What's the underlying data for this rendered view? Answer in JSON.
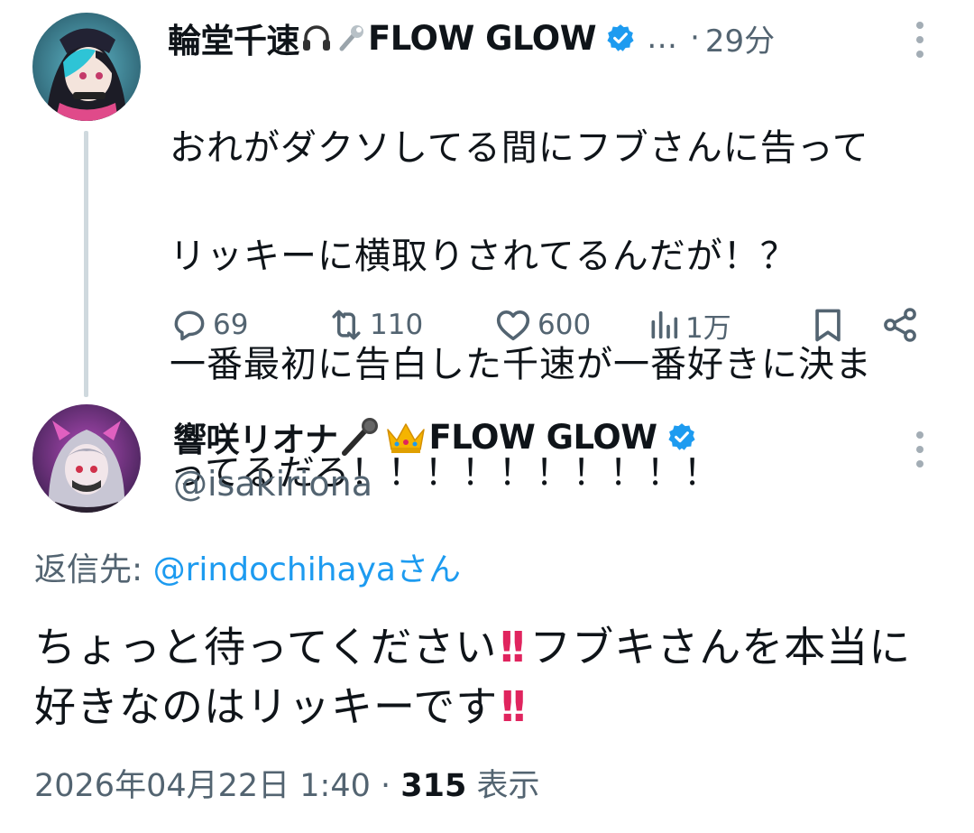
{
  "tweet1": {
    "display_name": "輪堂千速",
    "name_suffix": "FLOW GLOW",
    "ellipsis": "…",
    "separator": "·",
    "time": "29分",
    "text_lines": [
      "おれがダクソしてる間にフブさんに告って",
      "リッキーに横取りされてるんだが！？",
      "一番最初に告白した千速が一番好きに決ま",
      "ってるだろ！！！！！！！！！！"
    ],
    "actions": {
      "replies": "69",
      "reposts": "110",
      "likes": "600",
      "views": "1万"
    }
  },
  "tweet2": {
    "display_name": "響咲リオナ",
    "name_suffix": "FLOW GLOW",
    "handle": "@isakiriona",
    "reply_to_label": "返信先:",
    "reply_to_mention": "@rindochihaya",
    "reply_to_suffix": "さん",
    "text_part1": "ちょっと待ってください",
    "bang1": "!!",
    "text_part2": "フブキさんを本当に好きなのはリッキーです",
    "bang2": "!!",
    "date": "2026年04月22日 1:40",
    "separator": "·",
    "view_count": "315",
    "view_label": "表示"
  },
  "icons": [
    "headphones-icon",
    "wrench-icon",
    "verified-badge-icon",
    "microphone-icon",
    "crown-icon",
    "reply-icon",
    "repost-icon",
    "like-icon",
    "views-icon",
    "bookmark-icon",
    "share-icon",
    "more-icon"
  ],
  "colors": {
    "text": "#0f1419",
    "secondary": "#536471",
    "link": "#1d9bf0",
    "verified": "#1d9bf0",
    "thread_line": "#cfd9de",
    "bang": "#e0245e"
  }
}
